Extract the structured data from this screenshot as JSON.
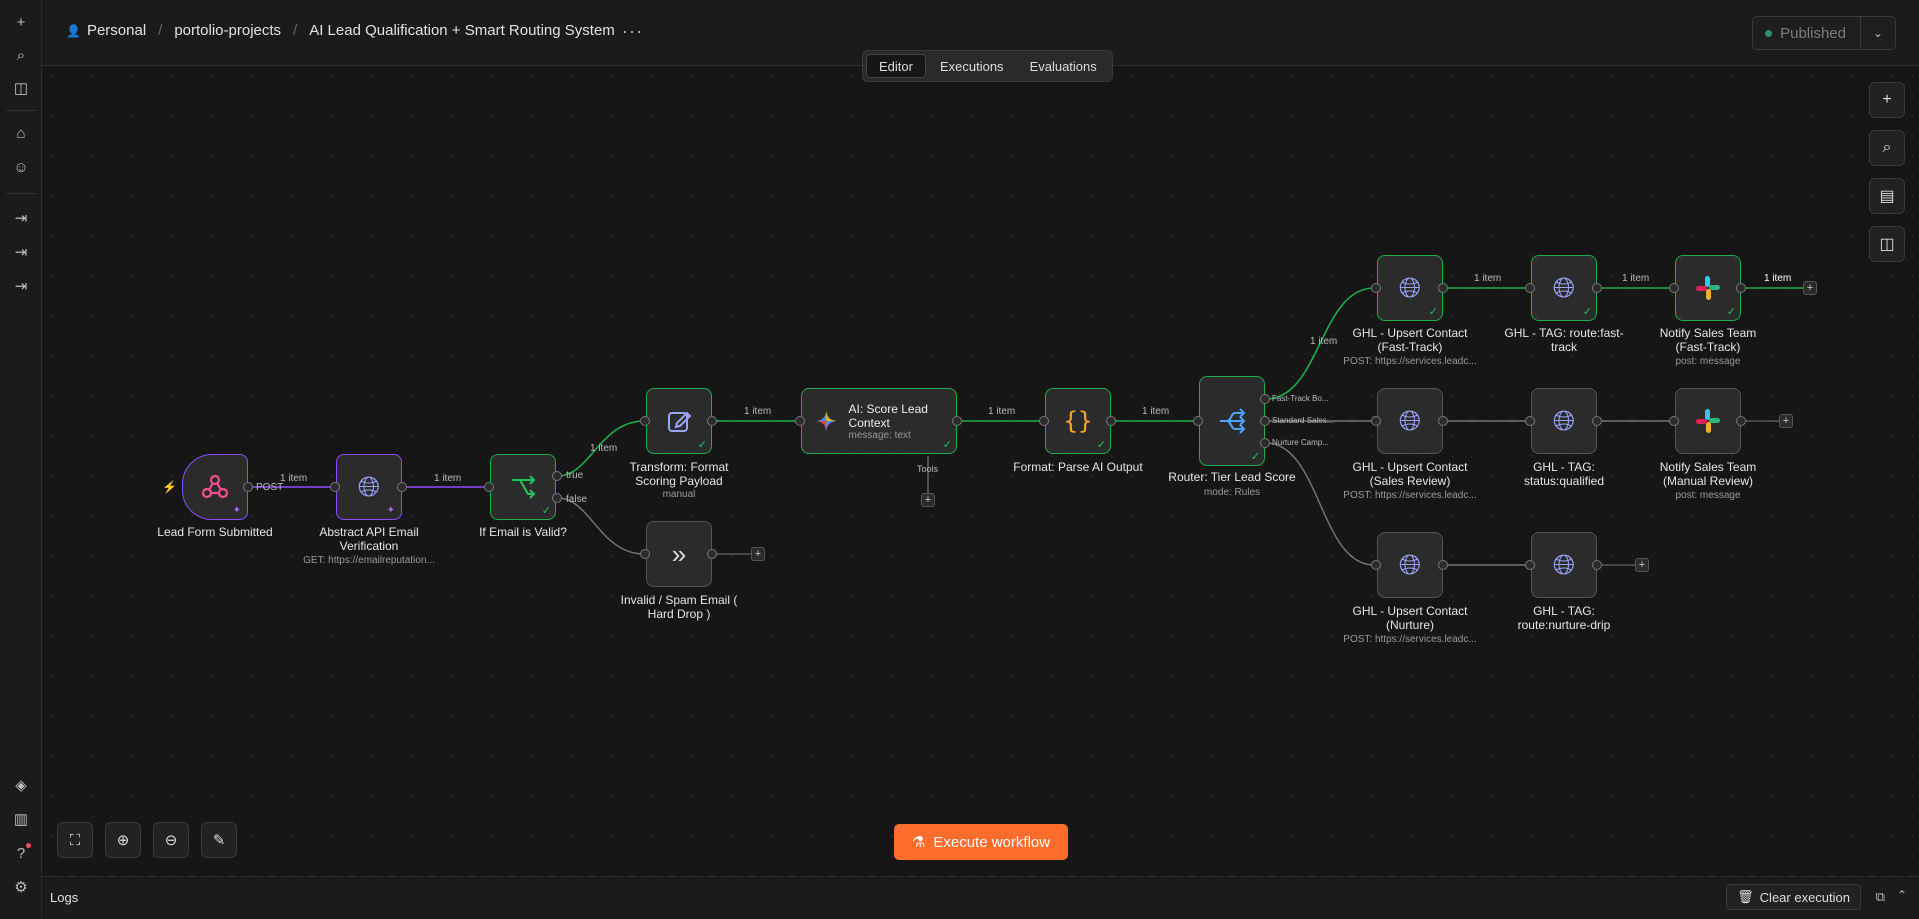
{
  "breadcrumb": {
    "owner": "Personal",
    "project": "portolio-projects",
    "workflow": "AI Lead Qualification + Smart Routing System"
  },
  "header": {
    "more": "···",
    "publish_label": "Published",
    "publish_status_color": "#2f8f6a"
  },
  "tabs": [
    "Editor",
    "Executions",
    "Evaluations"
  ],
  "nodes": {
    "trigger": {
      "label": "Lead Form Submitted"
    },
    "abstract": {
      "label": "Abstract API Email Verification",
      "sub": "GET: https://emailreputation..."
    },
    "ifvalid": {
      "label": "If Email is Valid?"
    },
    "transform": {
      "label": "Transform: Format Scoring Payload",
      "sub": "manual"
    },
    "invalid": {
      "label": "Invalid / Spam Email ( Hard Drop )"
    },
    "ai": {
      "title": "AI: Score Lead Context",
      "sub": "message: text",
      "tools": "Tools"
    },
    "parse": {
      "label": "Format: Parse AI Output"
    },
    "router": {
      "label": "Router: Tier Lead Score",
      "sub": "mode: Rules"
    },
    "ghl_fast": {
      "label": "GHL - Upsert Contact (Fast-Track)",
      "sub": "POST: https://services.leadc..."
    },
    "tag_fast": {
      "label": "GHL - TAG: route:fast-track"
    },
    "slack_fast": {
      "label": "Notify Sales Team (Fast-Track)",
      "sub": "post: message"
    },
    "ghl_review": {
      "label": "GHL - Upsert Contact (Sales Review)",
      "sub": "POST: https://services.leadc..."
    },
    "tag_review": {
      "label": "GHL - TAG: status:qualified"
    },
    "slack_review": {
      "label": "Notify Sales Team (Manual Review)",
      "sub": "post: message"
    },
    "ghl_nurture": {
      "label": "GHL - Upsert Contact (Nurture)",
      "sub": "POST: https://services.leadc..."
    },
    "tag_nurture": {
      "label": "GHL - TAG: route:nurture-drip"
    }
  },
  "edge_labels": {
    "post": "POST",
    "item": "1 item",
    "true": "true",
    "false": "false",
    "fast": "Fast-Track Bo...",
    "standard": "Standard Sales...",
    "nurture": "Nurture Camp..."
  },
  "execute_label": "Execute workflow",
  "logs": {
    "title": "Logs",
    "clear_label": "Clear execution"
  },
  "colors": {
    "success": "#1fae4b",
    "pinned": "#8a4dff",
    "accent": "#ff6d2d"
  }
}
